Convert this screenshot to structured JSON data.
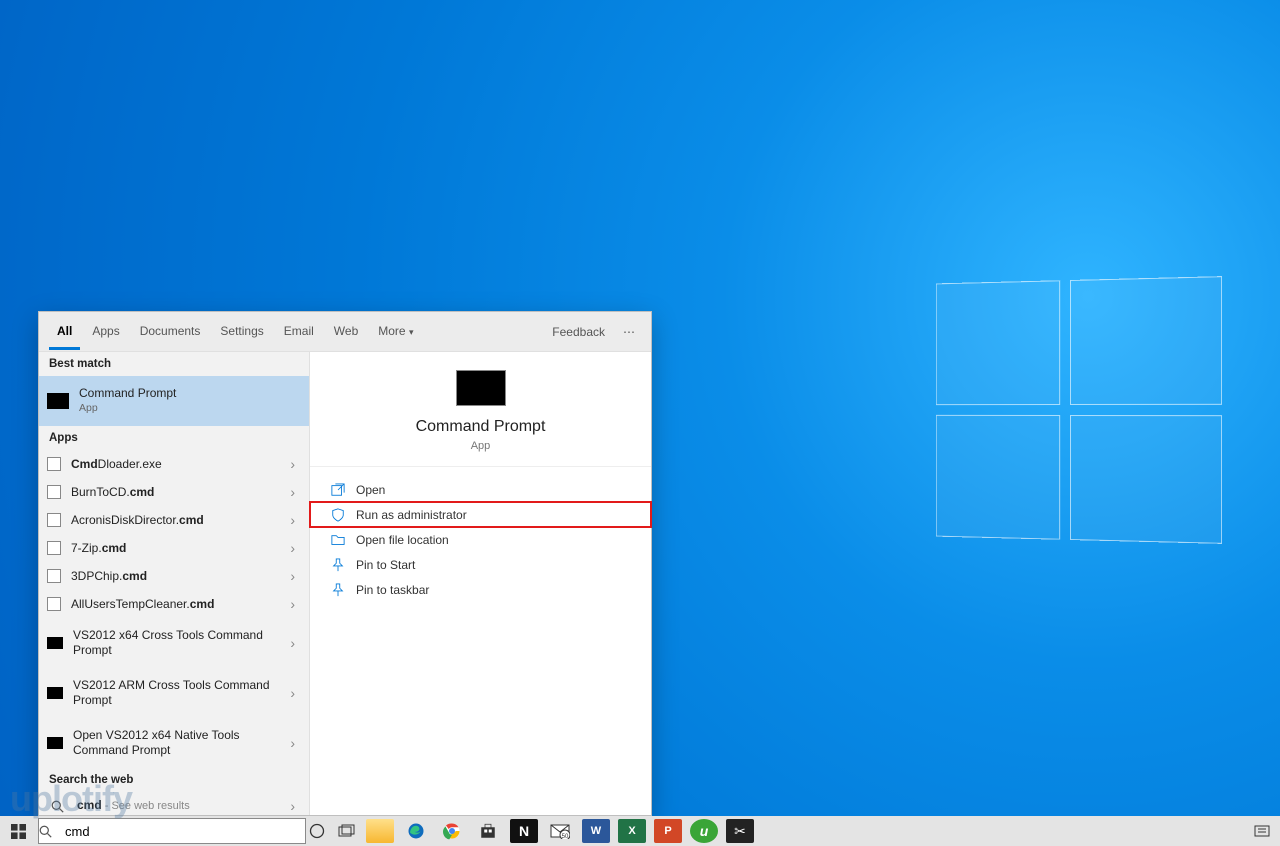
{
  "wallpaper": {
    "accent": "#0078d7"
  },
  "watermark": "uplotify",
  "taskbar": {
    "search_value": "cmd"
  },
  "flyout": {
    "tabs": {
      "all": "All",
      "apps": "Apps",
      "documents": "Documents",
      "settings": "Settings",
      "email": "Email",
      "web": "Web",
      "more": "More"
    },
    "feedback": "Feedback",
    "sections": {
      "best_match": "Best match",
      "apps": "Apps",
      "search_web": "Search the web"
    },
    "best_match": {
      "title": "Command Prompt",
      "subtitle": "App"
    },
    "apps_results": [
      {
        "prefix": "Cmd",
        "bold": "Dloader.exe",
        "swap": true
      },
      {
        "prefix": "BurnTo",
        "bold": "CD.cmd",
        "custom": true,
        "html": "BurnToCD.<b>cmd</b>"
      },
      {
        "html": "AcronisDiskDirector.<b>cmd</b>"
      },
      {
        "html": "7-Zip.<b>cmd</b>"
      },
      {
        "html": "3DPChip.<b>cmd</b>"
      },
      {
        "html": "AllUsersTempCleaner.<b>cmd</b>"
      },
      {
        "html": "VS2012 x64 Cross Tools Command Prompt",
        "tall": true,
        "black": true
      },
      {
        "html": "VS2012 ARM Cross Tools Command Prompt",
        "tall": true,
        "black": true
      },
      {
        "html": "Open VS2012 x64 Native Tools Command Prompt",
        "tall": true,
        "black": true
      }
    ],
    "web_result": {
      "term": "cmd",
      "hint": " - See web results"
    },
    "detail": {
      "title": "Command Prompt",
      "subtitle": "App",
      "actions": {
        "open": "Open",
        "run_admin": "Run as administrator",
        "open_location": "Open file location",
        "pin_start": "Pin to Start",
        "pin_taskbar": "Pin to taskbar"
      }
    }
  }
}
